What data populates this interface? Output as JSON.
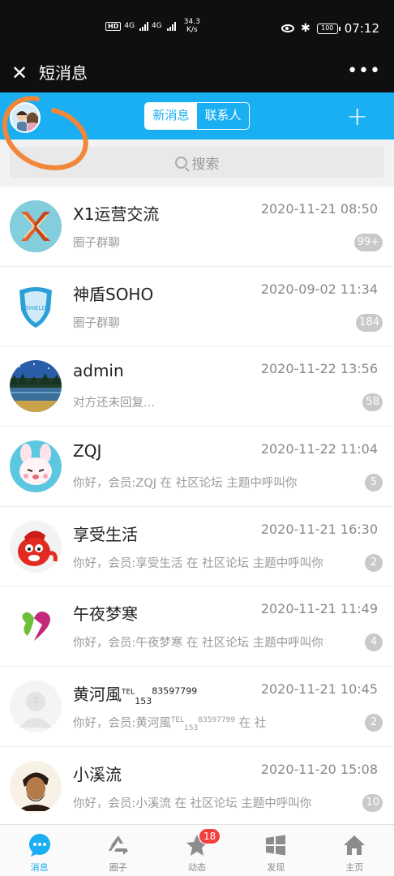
{
  "status_bar": {
    "hd": "HD",
    "net_a": "4G",
    "net_b": "4G",
    "speed_value": "34.3",
    "speed_unit": "K/s",
    "battery": "100",
    "time": "07:12"
  },
  "title_bar": {
    "title": "短消息"
  },
  "header": {
    "tabs": [
      {
        "label": "新消息",
        "active": true
      },
      {
        "label": "联系人",
        "active": false
      }
    ]
  },
  "search": {
    "placeholder": "搜索"
  },
  "conversations": [
    {
      "name": "X1运营交流",
      "time": "2020-11-21 08:50",
      "preview": "圈子群聊",
      "badge": "99+"
    },
    {
      "name": "神盾SOHO",
      "time": "2020-09-02 11:34",
      "preview": "圈子群聊",
      "badge": "184"
    },
    {
      "name": "admin",
      "time": "2020-11-22 13:56",
      "preview": "对方还未回复...",
      "badge": "58"
    },
    {
      "name": "ZQJ",
      "time": "2020-11-22 11:04",
      "preview": "你好，会员:ZQJ 在 社区论坛 主题中呼叫你",
      "badge": "5"
    },
    {
      "name": "享受生活",
      "time": "2020-11-21 16:30",
      "preview": "你好，会员:享受生活 在 社区论坛 主题中呼叫你",
      "badge": "2"
    },
    {
      "name": "午夜梦寒",
      "time": "2020-11-21 11:49",
      "preview": "你好，会员:午夜梦寒 在 社区论坛 主题中呼叫你",
      "badge": "4"
    },
    {
      "name_main": "黄河風",
      "name_tel": "TEL",
      "name_num_a": "153",
      "name_num_b": "8359",
      "name_num_c": "7799",
      "time": "2020-11-21 10:45",
      "preview_a": "你好，会员:黄河風",
      "preview_tel": "TEL",
      "preview_num_a": "153",
      "preview_num_b": "83597799",
      "preview_b": "在 社",
      "badge": "2"
    },
    {
      "name": "小溪流",
      "time": "2020-11-20 15:08",
      "preview": "你好，会员:小溪流 在 社区论坛 主题中呼叫你",
      "badge": "10"
    }
  ],
  "avatar_text": {
    "shield": "SHIELD"
  },
  "bottom_nav": {
    "items": [
      {
        "label": "消息",
        "icon": "chat-bubble-icon",
        "active": true
      },
      {
        "label": "圈子",
        "icon": "recycle-icon",
        "active": false
      },
      {
        "label": "动态",
        "icon": "star-icon",
        "active": false,
        "badge": "18"
      },
      {
        "label": "发现",
        "icon": "windows-icon",
        "active": false
      },
      {
        "label": "主页",
        "icon": "home-icon",
        "active": false
      }
    ]
  },
  "colors": {
    "accent": "#1aaef3",
    "dark_bar": "#0f0f0f",
    "badge_gray": "#c9c9c9",
    "badge_red": "#f43f3f",
    "scribble": "#f0873a"
  }
}
